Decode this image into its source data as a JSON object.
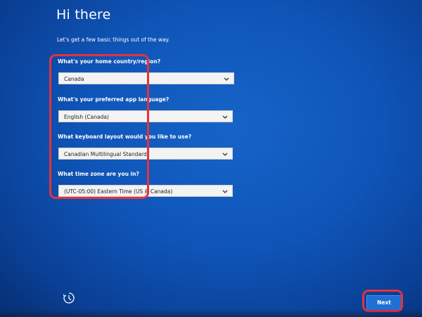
{
  "window": {
    "title": "Hi there",
    "subtitle": "Let's get a few basic things out of the way."
  },
  "fields": {
    "country": {
      "label": "What's your home country/region?",
      "value": "Canada"
    },
    "language": {
      "label": "What's your preferred app language?",
      "value": "English (Canada)"
    },
    "keyboard": {
      "label": "What keyboard layout would you like to use?",
      "value": "Canadian Multilingual Standard"
    },
    "timezone": {
      "label": "What time zone are you in?",
      "value": "(UTC-05:00) Eastern Time (US & Canada)"
    }
  },
  "footer": {
    "accessibility_icon": "accessibility-icon",
    "next_label": "Next"
  },
  "colors": {
    "background": "#0f55b8",
    "highlight": "#e8303a",
    "button": "#1f6fd6"
  }
}
